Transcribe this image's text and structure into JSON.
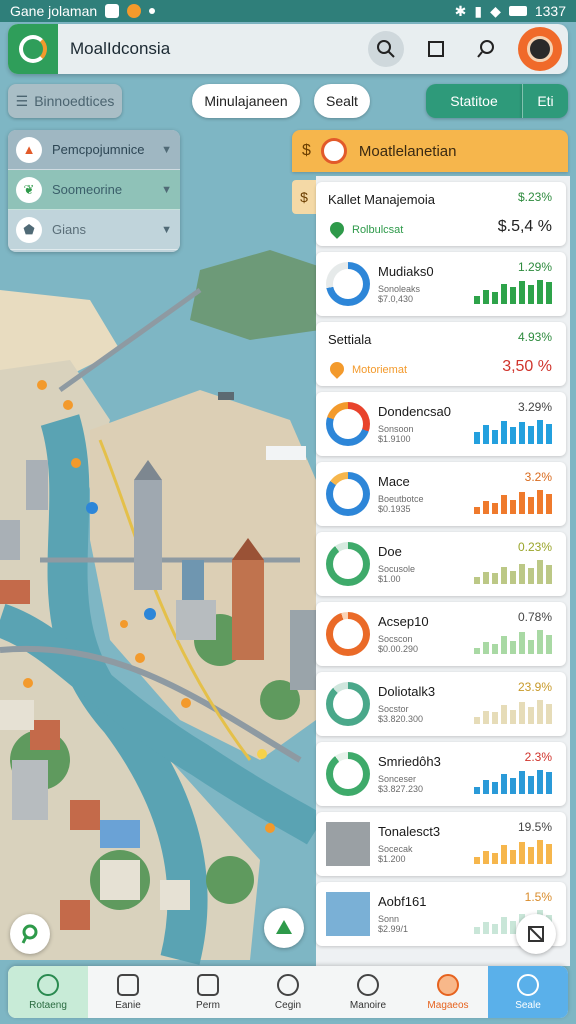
{
  "status_bar": {
    "app_name": "Gane jolaman",
    "time": "1337"
  },
  "header": {
    "title": "MoalIdconsia"
  },
  "filters": {
    "layers_chip": "Binnoedtices",
    "chip_search": "Minulajaneen",
    "chip_sort": "Sealt",
    "chip_stats": "Statitoe",
    "chip_edit": "Eti"
  },
  "layers": [
    {
      "label": "Pemcpojumnice"
    },
    {
      "label": "Soomeorine"
    },
    {
      "label": "Gians"
    }
  ],
  "panel": {
    "title": "Moatlelanetian"
  },
  "cards": [
    {
      "name": "Kallet Manajemoia",
      "sub": "Rolbulcsat",
      "pct": "$.23%",
      "big": "$.5,4 %",
      "pct_color": "#2e8b3e",
      "big_color": "#222",
      "kind": "summary",
      "pin_color": "#2e9a4a"
    },
    {
      "name": "Mudiaks0",
      "sub": "Sonoleaks\n$7.0,430",
      "pct": "1.29%",
      "pct_color": "#2e8b3e",
      "bar_color": "#2ea34a",
      "bars": [
        0.35,
        0.6,
        0.5,
        0.85,
        0.7,
        0.95,
        0.8,
        1.0,
        0.9
      ],
      "donut": [
        "#2d86d8",
        "#e6eaea"
      ],
      "donut_pct": 0.72
    },
    {
      "name": "Settiala",
      "sub": "Motoriemat",
      "pct": "4.93%",
      "big": "3,50 %",
      "pct_color": "#2e8b3e",
      "big_color": "#d0342c",
      "kind": "summary",
      "pin_color": "#f39a2c"
    },
    {
      "name": "Dondencsa0",
      "sub": "Sonsoon\n$1.9100",
      "pct": "3.29%",
      "pct_color": "#444",
      "bar_color": "#23a0de",
      "bars": [
        0.5,
        0.8,
        0.6,
        0.95,
        0.7,
        0.9,
        0.75,
        1.0,
        0.85
      ],
      "donut": [
        "#e8432c",
        "#2d86d8",
        "#f39a2c"
      ],
      "donut_pct": 0.8
    },
    {
      "name": "Mace",
      "sub": "Boeutbotce\n$0.1935",
      "pct": "3.2%",
      "pct_color": "#d96b1e",
      "bar_color": "#ef7a2c",
      "bars": [
        0.3,
        0.55,
        0.45,
        0.8,
        0.6,
        0.9,
        0.7,
        1.0,
        0.85
      ],
      "donut": [
        "#2d86d8",
        "#f6b64c"
      ],
      "donut_pct": 0.85
    },
    {
      "name": "Doe",
      "sub": "Socusole\n$1.00",
      "pct": "0.23%",
      "pct_color": "#9aa52a",
      "bar_color": "#bcc886",
      "bars": [
        0.3,
        0.5,
        0.45,
        0.7,
        0.55,
        0.85,
        0.65,
        1.0,
        0.8
      ],
      "donut": [
        "#3eaa6a",
        "#d6eadf"
      ],
      "donut_pct": 0.9
    },
    {
      "name": "Acsep10",
      "sub": "Socscon\n$0.00.290",
      "pct": "0.78%",
      "pct_color": "#444",
      "bar_color": "#a9d9a4",
      "bars": [
        0.25,
        0.5,
        0.4,
        0.75,
        0.55,
        0.9,
        0.6,
        1.0,
        0.8
      ],
      "donut": [
        "#ea6a28",
        "#f9d3b6"
      ],
      "donut_pct": 0.95
    },
    {
      "name": "Doliotalk3",
      "sub": "Socstor\n$3.820.300",
      "pct": "23.9%",
      "pct_color": "#c89a2a",
      "bar_color": "#e6dcb8",
      "bars": [
        0.3,
        0.55,
        0.5,
        0.8,
        0.6,
        0.9,
        0.7,
        1.0,
        0.85
      ],
      "donut": [
        "#4aa88a",
        "#cfe6dd"
      ],
      "donut_pct": 0.88
    },
    {
      "name": "Smriedôh3",
      "sub": "Sonceser\n$3.827.230",
      "pct": "2.3%",
      "pct_color": "#d0342c",
      "bar_color": "#2a9ad8",
      "bars": [
        0.3,
        0.6,
        0.5,
        0.85,
        0.65,
        0.95,
        0.75,
        1.0,
        0.9
      ],
      "donut": [
        "#3eaa6a",
        "#e6f2ea"
      ],
      "donut_pct": 0.9
    },
    {
      "name": "Tonalesct3",
      "sub": "Socecak\n$1.200",
      "pct": "19.5%",
      "pct_color": "#444",
      "bar_color": "#f6b64c",
      "bars": [
        0.3,
        0.55,
        0.45,
        0.8,
        0.6,
        0.9,
        0.7,
        1.0,
        0.85
      ],
      "kind": "photo"
    },
    {
      "name": "Aobf161",
      "sub": "Sonn\n$2.99/1",
      "pct": "1.5%",
      "pct_color": "#d98b2a",
      "bar_color": "#c9e6d8",
      "bars": [
        0.3,
        0.5,
        0.4,
        0.7,
        0.55,
        0.85,
        0.6,
        1.0,
        0.8
      ],
      "kind": "photo"
    }
  ],
  "nav": [
    {
      "label": "Rotaeng"
    },
    {
      "label": "Eanie"
    },
    {
      "label": "Perm"
    },
    {
      "label": "Cegin"
    },
    {
      "label": "Manoire"
    },
    {
      "label": "Magaeos"
    },
    {
      "label": "Seale"
    }
  ],
  "colors": {
    "primary": "#2e9a7a",
    "accent": "#f6b64c",
    "water": "#6fa9b8"
  }
}
